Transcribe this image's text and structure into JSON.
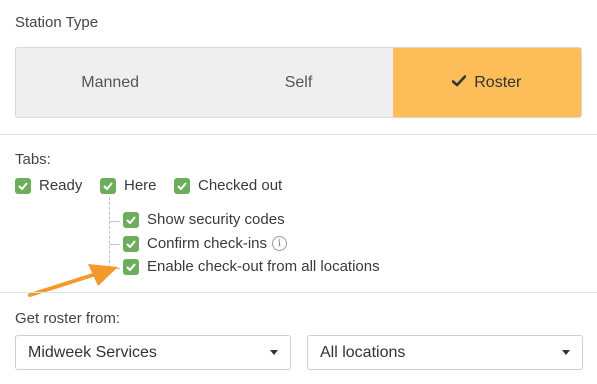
{
  "station_type": {
    "label": "Station Type",
    "options": [
      {
        "label": "Manned",
        "active": false
      },
      {
        "label": "Self",
        "active": false
      },
      {
        "label": "Roster",
        "active": true
      }
    ]
  },
  "tabs": {
    "label": "Tabs:",
    "items": [
      {
        "label": "Ready",
        "checked": true
      },
      {
        "label": "Here",
        "checked": true
      },
      {
        "label": "Checked out",
        "checked": true
      }
    ],
    "sub_options": [
      {
        "label": "Show security codes",
        "checked": true
      },
      {
        "label": "Confirm check-ins",
        "checked": true,
        "info_icon": true
      },
      {
        "label": "Enable check-out from all locations",
        "checked": true
      }
    ]
  },
  "roster": {
    "label": "Get roster from:",
    "service_select": "Midweek Services",
    "location_select": "All locations"
  },
  "colors": {
    "accent": "#fdbe5a",
    "checkbox": "#6cae5c",
    "arrow": "#f39a2c"
  }
}
